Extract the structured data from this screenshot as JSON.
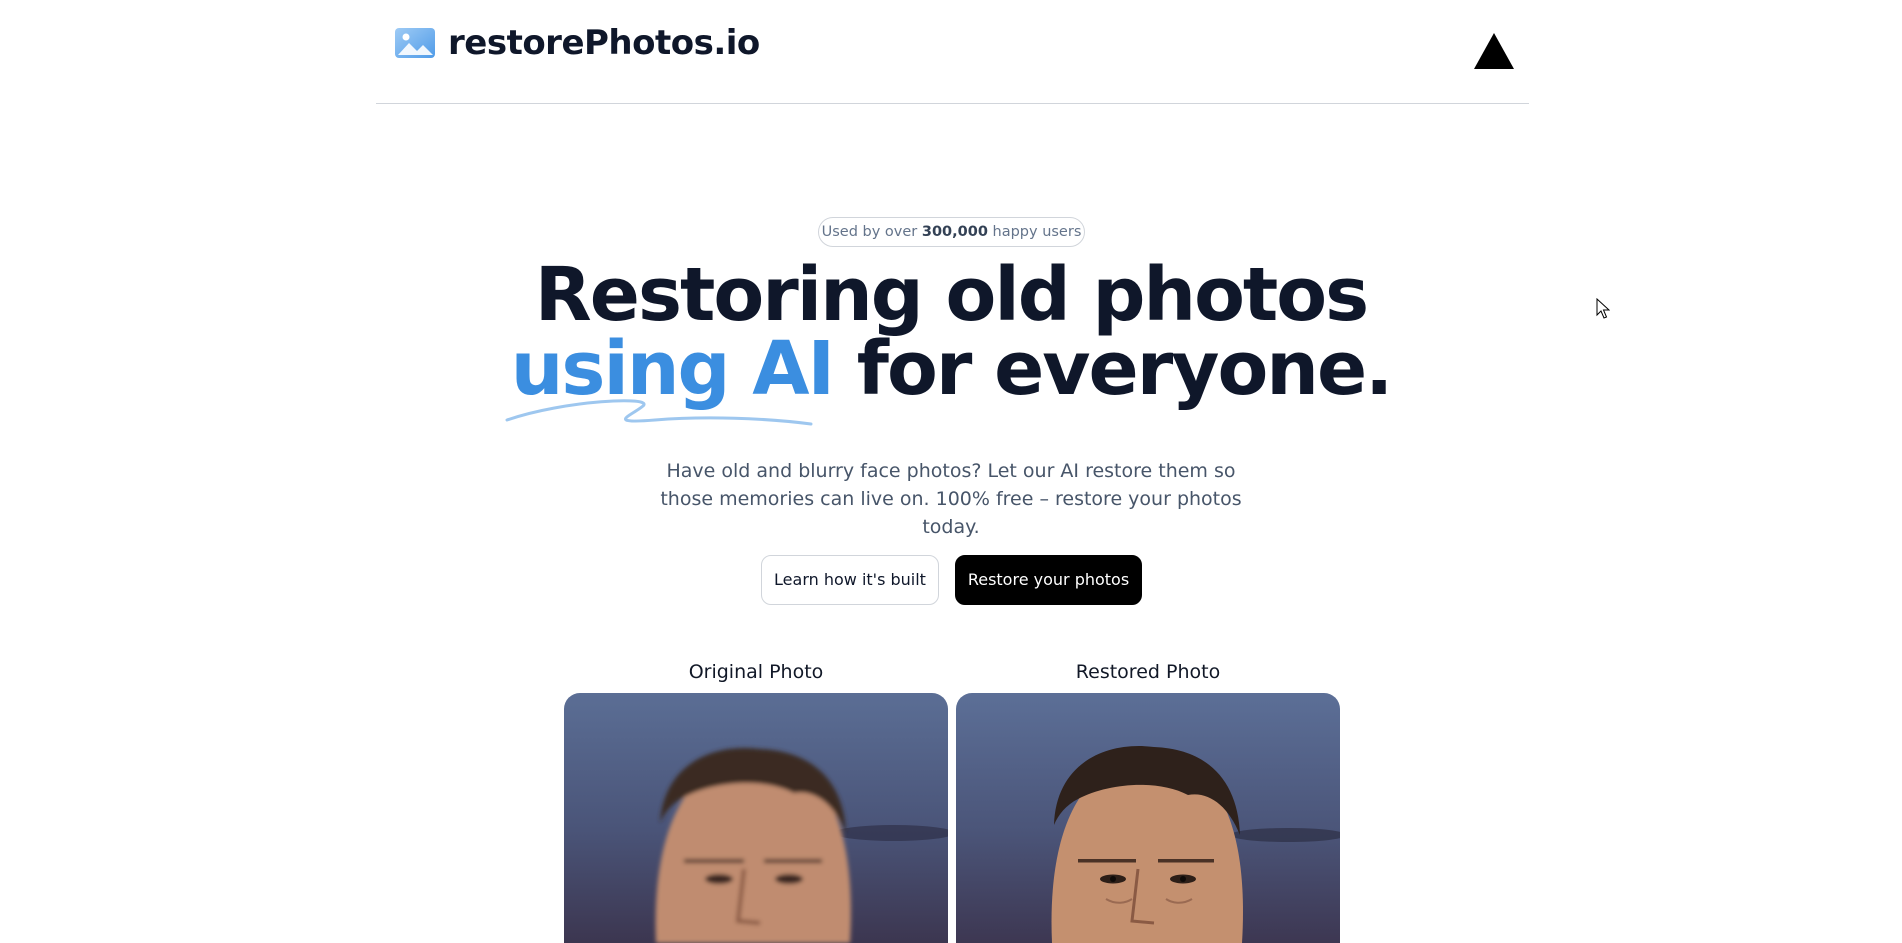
{
  "header": {
    "brand_name": "restorePhotos.io",
    "brand_icon": "photo-icon",
    "right_icon": "vercel-triangle-icon"
  },
  "hero": {
    "badge": {
      "prefix": "Used by over ",
      "count": "300,000",
      "suffix": " happy users"
    },
    "headline": {
      "line1": "Restoring old photos",
      "accent": "using AI",
      "rest": " for everyone."
    },
    "subtitle": "Have old and blurry face photos? Let our AI restore them so those memories can live on. 100% free – restore your photos today.",
    "buttons": {
      "secondary": "Learn how it's built",
      "primary": "Restore your photos"
    }
  },
  "comparison": {
    "original_label": "Original Photo",
    "restored_label": "Restored Photo"
  },
  "colors": {
    "accent": "#3b8ee0",
    "text_dark": "#0f172a",
    "text_muted": "#475569",
    "button_primary_bg": "#000000"
  }
}
